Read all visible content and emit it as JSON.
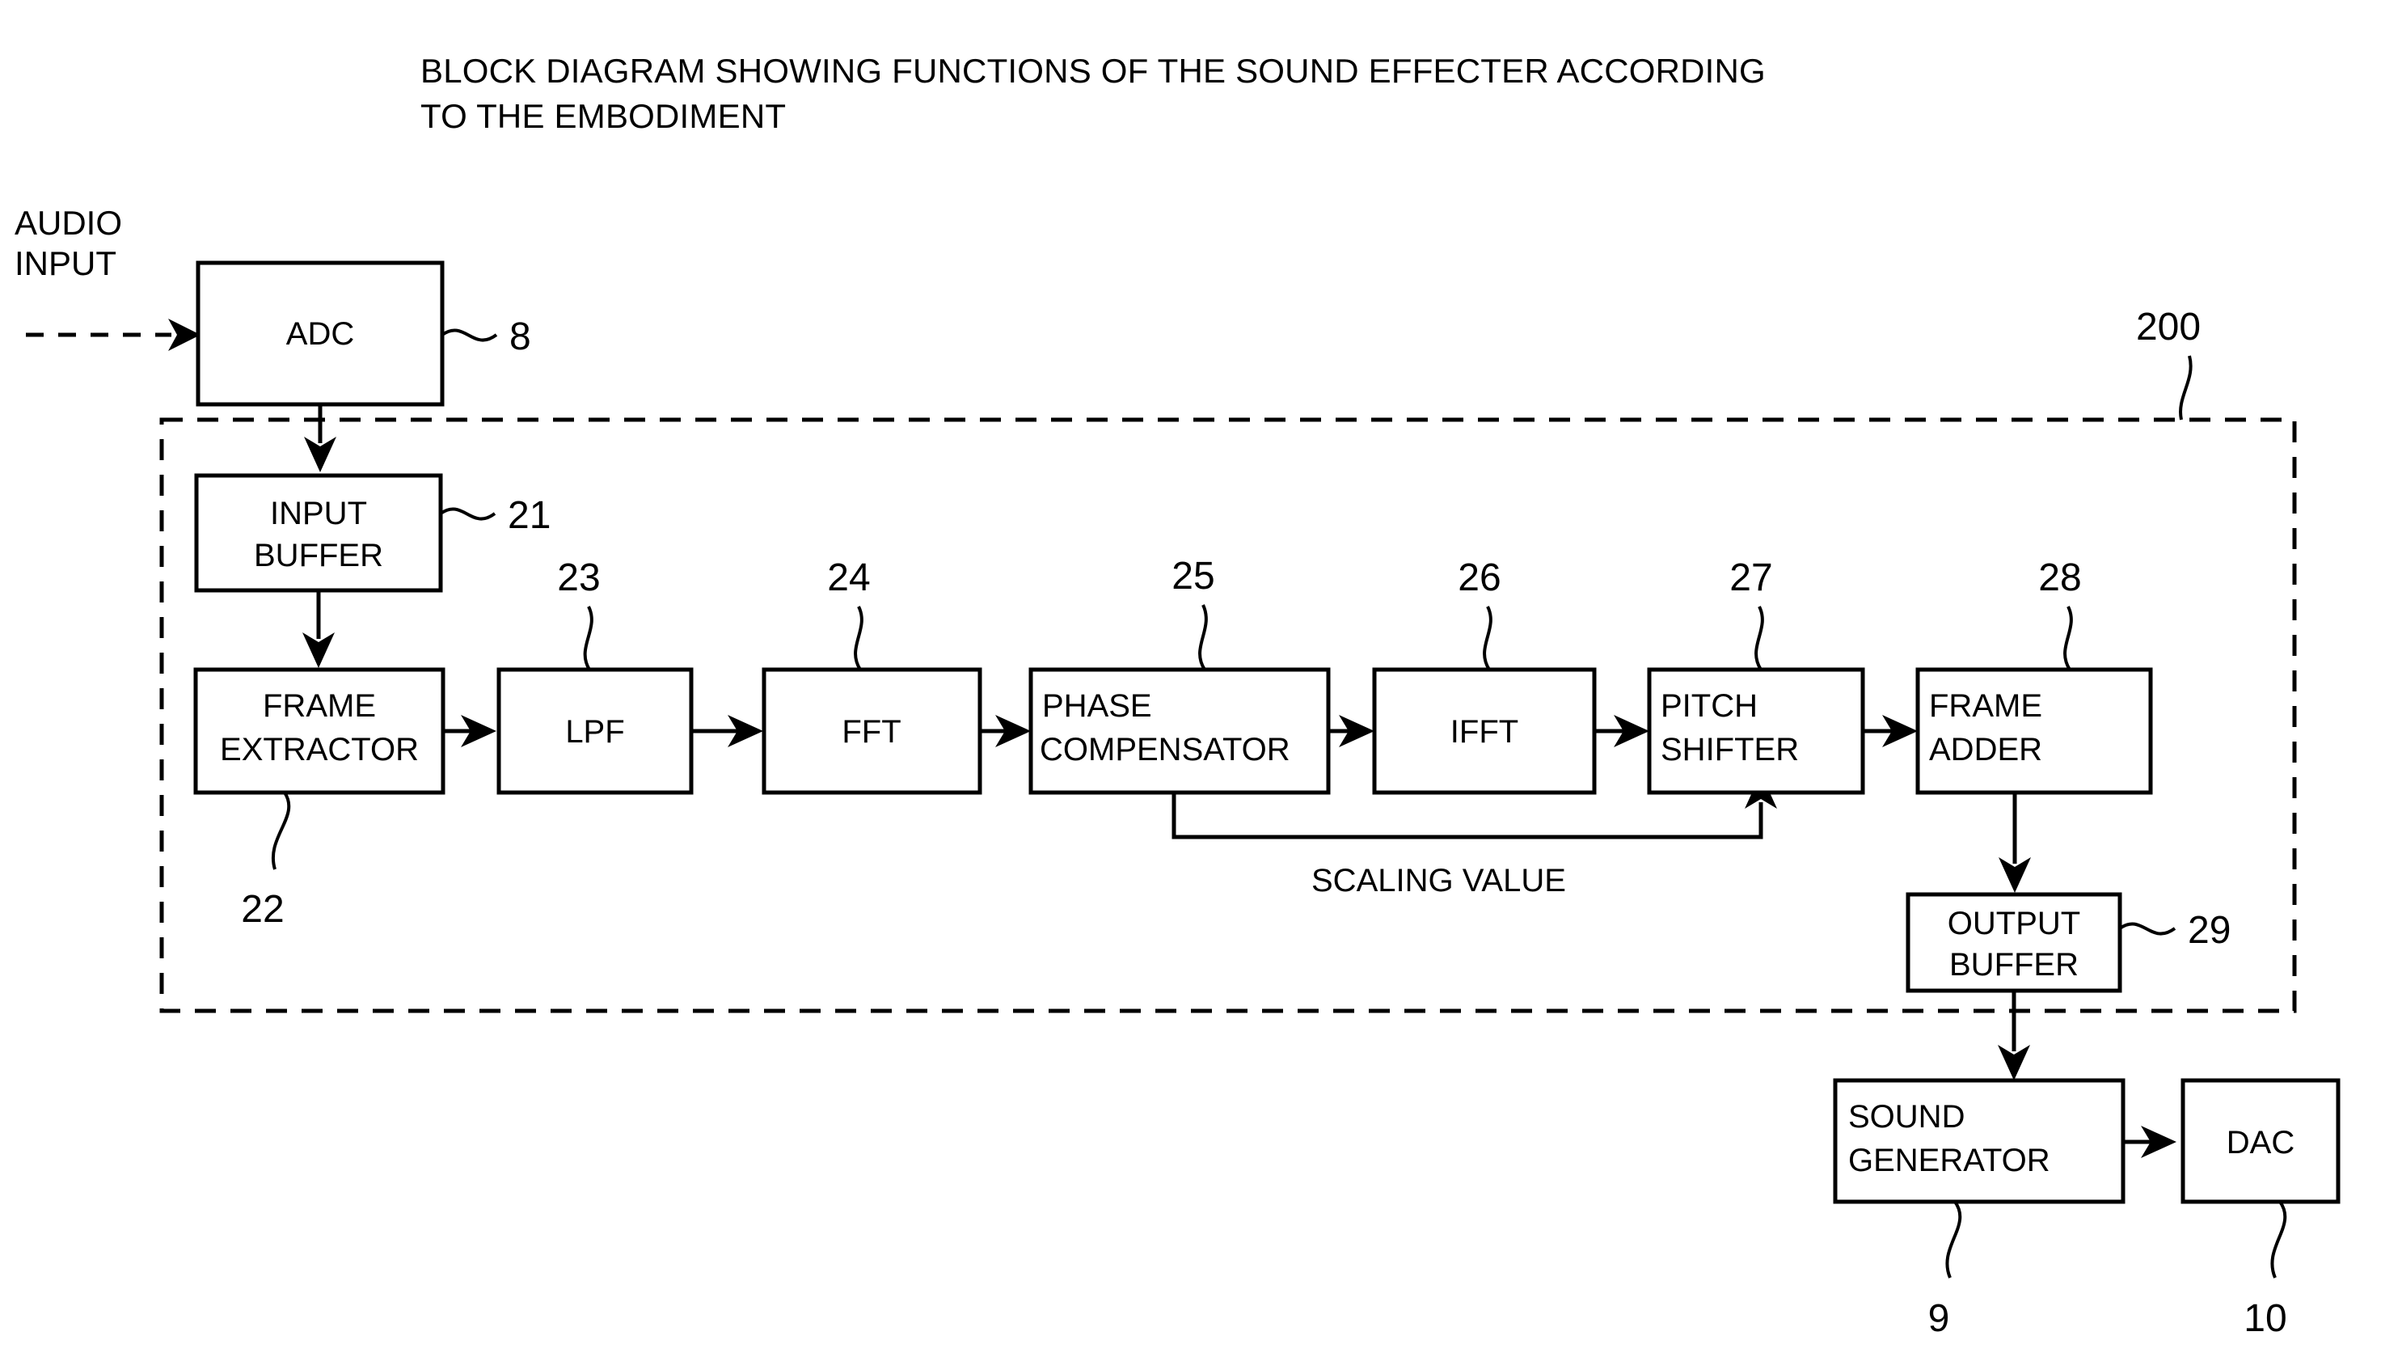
{
  "figure": {
    "title": "BLOCK DIAGRAM SHOWING FUNCTIONS OF THE SOUND EFFECTER ACCORDING\nTO THE EMBODIMENT",
    "container_ref": "200"
  },
  "io": {
    "audio_input_label": "AUDIO\nINPUT"
  },
  "signals": {
    "scaling_value": "SCALING VALUE"
  },
  "blocks": {
    "adc": {
      "label": "ADC",
      "ref": "8"
    },
    "input_buffer": {
      "label": "INPUT\nBUFFER",
      "ref": "21"
    },
    "frame_extractor": {
      "label": "FRAME\nEXTRACTOR",
      "ref": "22"
    },
    "lpf": {
      "label": "LPF",
      "ref": "23"
    },
    "fft": {
      "label": "FFT",
      "ref": "24"
    },
    "phase_compensator": {
      "label": "PHASE\nCOMPENSATOR",
      "ref": "25"
    },
    "ifft": {
      "label": "IFFT",
      "ref": "26"
    },
    "pitch_shifter": {
      "label": "PITCH\nSHIFTER",
      "ref": "27"
    },
    "frame_adder": {
      "label": "FRAME\nADDER",
      "ref": "28"
    },
    "output_buffer": {
      "label": "OUTPUT\nBUFFER",
      "ref": "29"
    },
    "sound_generator": {
      "label": "SOUND\nGENERATOR",
      "ref": "9"
    },
    "dac": {
      "label": "DAC",
      "ref": "10"
    }
  },
  "colors": {
    "ink": "#000000",
    "paper": "#ffffff"
  }
}
